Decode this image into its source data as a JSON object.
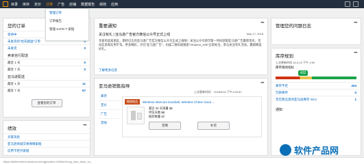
{
  "nav": {
    "items": [
      "目录",
      "库存",
      "定价",
      "订单",
      "广告",
      "店铺",
      "数据报告",
      "绩效",
      "应用"
    ],
    "active_index": 3
  },
  "dropdown": {
    "items": [
      "管理订单",
      "订单报告",
      "管理 SAFE-T 索赔"
    ]
  },
  "orders": {
    "title": "您的订单",
    "rows": [
      {
        "label": "等待中",
        "value": "0"
      },
      {
        "label": "未发货的“优先配送”订单",
        "value": "0"
      },
      {
        "label": "未发货",
        "value": "0"
      }
    ],
    "seller_title": "卖家自行配送",
    "seller_rows": [
      {
        "label": "最近 1 天",
        "value": "0"
      },
      {
        "label": "最近 7 天",
        "value": "0"
      }
    ],
    "fba_title": "亚马逊配送",
    "fba_rows": [
      {
        "label": "最近 1 天",
        "value": "11"
      },
      {
        "label": "最近 7 天",
        "value": "67"
      }
    ],
    "view_button": "查看您的订单"
  },
  "performance": {
    "title": "绩效",
    "rows": [
      "买家消息",
      "亚马逊商城交易保障索赔",
      "信用卡拒付索赔"
    ]
  },
  "news": {
    "title": "重要通知",
    "headline": "关注有礼 | 亚马逊广告官方微信公众号正式上线",
    "date": "May 17, 2018",
    "body": "亲爱的卖家朋友，期待已久的亚马逊广告官方微信公众号正式上线啦！关注公众号即可第一时间获取亚马逊广告最新资讯、活动信息和实用干货。更多精彩，尽在“亚马逊广告”，扫描二维码或搜索“Amazon_Ads”立即关注，参与关注有礼活动，赢取精美好礼。",
    "more_link": "了解更多信息"
  },
  "sales": {
    "title": "亚马逊销售指导",
    "updated": "上次更新时间： 2018/5/24 下午1:50:51",
    "tabs": [
      "库存",
      "定价",
      "广告",
      "其他"
    ],
    "badge": "畅销商品",
    "product": "Wireless Intercom Doorbell, Wireless Chime Voice ...",
    "stats": [
      {
        "label": "最近 30 天销量",
        "value": "32"
      },
      {
        "label": "供货天数",
        "value": "52"
      },
      {
        "label": "推荐数量",
        "value": "17"
      }
    ],
    "btn_ignore": "忽略",
    "btn_replenish": "补货"
  },
  "problem_log": {
    "title": "管理您的问题日志"
  },
  "inventory": {
    "title": "库存规划",
    "updated": "上次更新时间 16-5-23 下午 1:50",
    "perf_label": "库存绩效指标",
    "score": "432",
    "rows": [
      {
        "label": "库存不足",
        "value": "204"
      },
      {
        "label": "冗余库存",
        "value": "0"
      },
      {
        "label": "无在售信息的亚马逊库存 SKU",
        "value": "1"
      }
    ],
    "notice_title": "通知"
  },
  "footer": {
    "url": "https://sellercentral.amazon.com/gp/orders-v2/list/ref=ag_myo_dnav_xx_"
  },
  "watermark": {
    "text": "软件产品网"
  },
  "colors": {
    "nav_bg": "#232f3e",
    "accent": "#ff9900",
    "link": "#0066c0",
    "badge": "#c7511f",
    "score": "#1aa34a"
  }
}
